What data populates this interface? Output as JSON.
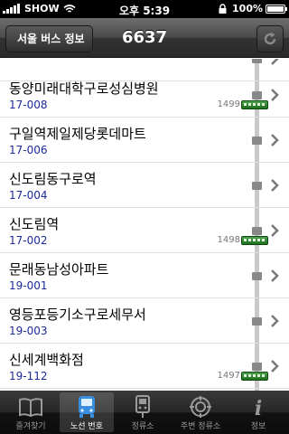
{
  "status_bar": {
    "carrier": "SHOW",
    "time": "오후 5:39",
    "battery": "100%"
  },
  "nav": {
    "back_label": "서울 버스 정보",
    "title": "6637"
  },
  "stops": [
    {
      "name": "동양미래대학구로성심병원",
      "code": "17-008",
      "bus": "1499"
    },
    {
      "name": "구일역제일제당롯데마트",
      "code": "17-006",
      "bus": ""
    },
    {
      "name": "신도림동구로역",
      "code": "17-004",
      "bus": ""
    },
    {
      "name": "신도림역",
      "code": "17-002",
      "bus": "1498"
    },
    {
      "name": "문래동남성아파트",
      "code": "19-001",
      "bus": ""
    },
    {
      "name": "영등포등기소구로세무서",
      "code": "19-003",
      "bus": ""
    },
    {
      "name": "신세계백화점",
      "code": "19-112",
      "bus": "1497"
    }
  ],
  "tabs": [
    {
      "label": "즐겨찾기",
      "icon": "book-icon",
      "active": false
    },
    {
      "label": "노선 번호",
      "icon": "bus-icon",
      "active": true
    },
    {
      "label": "정류소",
      "icon": "bus-stop-icon",
      "active": false
    },
    {
      "label": "주변 정류소",
      "icon": "compass-icon",
      "active": false
    },
    {
      "label": "정보",
      "icon": "info-icon",
      "active": false
    }
  ],
  "colors": {
    "code_text": "#1c2a9c",
    "bus_green": "#2e8b2e",
    "nav_bg": "#3a3a3a"
  }
}
